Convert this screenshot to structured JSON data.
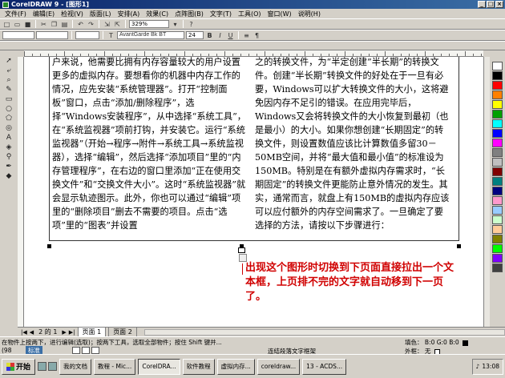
{
  "window": {
    "title": "CorelDRAW 9 - [图形1]"
  },
  "menus": [
    "文件(F)",
    "编辑(E)",
    "检视(V)",
    "版面(L)",
    "安排(A)",
    "效果(C)",
    "点阵图(B)",
    "文字(T)",
    "工具(O)",
    "窗口(W)",
    "说明(H)"
  ],
  "toolbar": {
    "zoom_value": "329%",
    "font_name": "AvantGarde Bk BT",
    "font_size": "24",
    "bold": "B",
    "italic": "I",
    "underline": "U"
  },
  "text_frame_1": "户来说，他需要比拥有内存容量较大的用户设置更多的虚拟内存。要想看你的机器中内存工作的情况，应先安装“系统管理器”。打开“控制面板”窗口，点击“添加/删除程序”，选择“Windows安装程序”，从中选择“系统工具”，在“系统监视器”项前打钩，并安装它。运行“系统监视器”（开始→程序→附件→系统工具→系统监视器），选择“编辑”，然后选择“添加项目”里的“内存管理程序”，在右边的窗口里添加“正在使用交换文件”和“交换文件大小”。这时“系统监视器”就会显示轨迹图示。此外，你也可以通过“编辑”项里的“删除项目”删去不需要的项目。点击“选项”里的“图表”并设置",
  "text_frame_2": "之的转换文件，为“半定创建”半长期”的转换文件。创建“半长期”转换文件的好处在于一旦有必要，Windows可以扩大转换文件的大小，这将避免因内存不足引的错误。在应用完毕后，Windows又会将转换文件的大小恢复到最初（也是最小）的大小。如果你想创建“长期固定”的转换文件，则设置数值应该比计算数值多留30－50MB空间，并将“最大值和最小值”的标准设为150MB。特别是在有额外虚拟内存需求时，“长期固定”的转换文件更能防止意外情况的发生。其实，通常而言，就盘上有150MB的虚拟内存应该可以应付额外的内存空间需求了。一旦确定了要选择的方法，请按以下步骤进行：",
  "annotation": "出现这个图形时切换到下页面直接拉出一个文本框，上页排不完的文字就自动移到下一页了。",
  "page_tabs": {
    "counter": "2 的 1",
    "tabs": [
      "页面 1",
      "页面 2"
    ]
  },
  "status": {
    "hint": "在物件上按两下，进行编辑(选取)；按两下工具，选取全部物件；按住 Shift 键并...",
    "coord": "(98",
    "mode": "标准",
    "middle": "连结段落文字框架",
    "fill": "填色：",
    "fill_value": "B:0 G:0 B:0",
    "outline": "外框：",
    "outline_value": "无"
  },
  "taskbar": {
    "start": "开始",
    "tasks": [
      "我的文档",
      "教程 - Mic...",
      "CorelDRA...",
      "软件教程",
      "虚拟内存...",
      "coreldraw...",
      "13 - ACDS..."
    ],
    "time": "13:08"
  },
  "colors": {
    "annotation": "#d00000",
    "title_bar": "#0a246a"
  }
}
